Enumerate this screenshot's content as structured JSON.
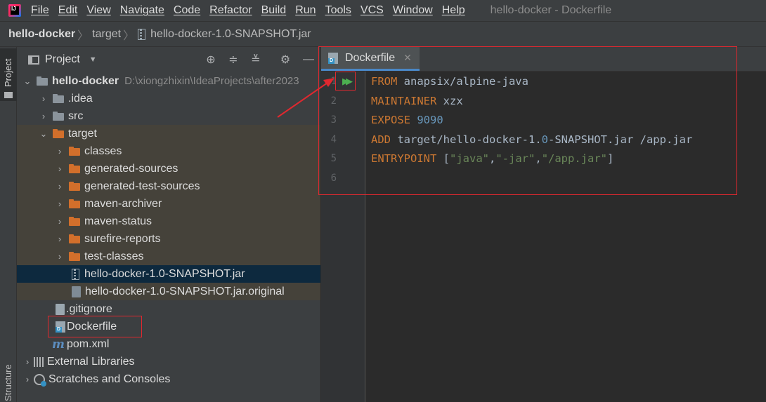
{
  "menubar": {
    "items": [
      "File",
      "Edit",
      "View",
      "Navigate",
      "Code",
      "Refactor",
      "Build",
      "Run",
      "Tools",
      "VCS",
      "Window",
      "Help"
    ],
    "window_title": "hello-docker - Dockerfile"
  },
  "breadcrumb": {
    "root": "hello-docker",
    "target": "target",
    "file": "hello-docker-1.0-SNAPSHOT.jar"
  },
  "stripe": {
    "project_label": "Project",
    "bottom_label": "Structure"
  },
  "project_panel": {
    "title": "Project",
    "tree": [
      {
        "label": "hello-docker",
        "path": "D:\\xiongzhixin\\IdeaProjects\\after2023"
      },
      {
        "label": ".idea"
      },
      {
        "label": "src"
      },
      {
        "label": "target"
      },
      {
        "label": "classes"
      },
      {
        "label": "generated-sources"
      },
      {
        "label": "generated-test-sources"
      },
      {
        "label": "maven-archiver"
      },
      {
        "label": "maven-status"
      },
      {
        "label": "surefire-reports"
      },
      {
        "label": "test-classes"
      },
      {
        "label": "hello-docker-1.0-SNAPSHOT.jar"
      },
      {
        "label": "hello-docker-1.0-SNAPSHOT.jar.original"
      },
      {
        "label": ".gitignore"
      },
      {
        "label": "Dockerfile"
      },
      {
        "label": "pom.xml"
      },
      {
        "label": "External Libraries"
      },
      {
        "label": "Scratches and Consoles"
      }
    ]
  },
  "editor": {
    "tab_label": "Dockerfile",
    "line_numbers": [
      "1",
      "2",
      "3",
      "4",
      "5",
      "6"
    ],
    "lines": [
      {
        "kw": "FROM",
        "rest": " anapsix/alpine-java"
      },
      {
        "kw": "MAINTAINER",
        "rest": " xzx"
      },
      {
        "kw": "EXPOSE",
        "num": " 9090"
      },
      {
        "kw": "ADD",
        "rest_a": " target/hello-docker-1.",
        "num": "0",
        "rest_b": "-SNAPSHOT.jar /app.jar"
      },
      {
        "kw": "ENTRYPOINT",
        "p1": " [",
        "s1": "\"java\"",
        "c1": ",",
        "s2": "\"-jar\"",
        "c2": ",",
        "s3": "\"/app.jar\"",
        "p2": "]"
      }
    ]
  },
  "colors": {
    "accent": "#4a88c7",
    "annotation": "#e0282f",
    "keyword": "#cc7832",
    "string": "#6a8759",
    "number": "#6897bb"
  }
}
